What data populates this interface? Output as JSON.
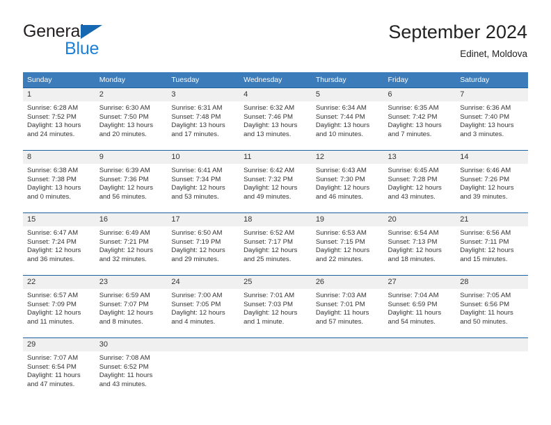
{
  "brand": {
    "name_line1": "General",
    "name_line2": "Blue",
    "color_dark": "#231f20",
    "color_blue": "#1a80d9",
    "triangle_color": "#1667b2"
  },
  "header": {
    "title": "September 2024",
    "subtitle": "Edinet, Moldova"
  },
  "theme": {
    "header_bg": "#3c7cba",
    "row_border": "#1a5fa0",
    "daynum_bg": "#f0f0f0",
    "text": "#333333"
  },
  "weekdays": [
    "Sunday",
    "Monday",
    "Tuesday",
    "Wednesday",
    "Thursday",
    "Friday",
    "Saturday"
  ],
  "weeks": [
    [
      {
        "day": "1",
        "sunrise": "Sunrise: 6:28 AM",
        "sunset": "Sunset: 7:52 PM",
        "daylight1": "Daylight: 13 hours",
        "daylight2": "and 24 minutes."
      },
      {
        "day": "2",
        "sunrise": "Sunrise: 6:30 AM",
        "sunset": "Sunset: 7:50 PM",
        "daylight1": "Daylight: 13 hours",
        "daylight2": "and 20 minutes."
      },
      {
        "day": "3",
        "sunrise": "Sunrise: 6:31 AM",
        "sunset": "Sunset: 7:48 PM",
        "daylight1": "Daylight: 13 hours",
        "daylight2": "and 17 minutes."
      },
      {
        "day": "4",
        "sunrise": "Sunrise: 6:32 AM",
        "sunset": "Sunset: 7:46 PM",
        "daylight1": "Daylight: 13 hours",
        "daylight2": "and 13 minutes."
      },
      {
        "day": "5",
        "sunrise": "Sunrise: 6:34 AM",
        "sunset": "Sunset: 7:44 PM",
        "daylight1": "Daylight: 13 hours",
        "daylight2": "and 10 minutes."
      },
      {
        "day": "6",
        "sunrise": "Sunrise: 6:35 AM",
        "sunset": "Sunset: 7:42 PM",
        "daylight1": "Daylight: 13 hours",
        "daylight2": "and 7 minutes."
      },
      {
        "day": "7",
        "sunrise": "Sunrise: 6:36 AM",
        "sunset": "Sunset: 7:40 PM",
        "daylight1": "Daylight: 13 hours",
        "daylight2": "and 3 minutes."
      }
    ],
    [
      {
        "day": "8",
        "sunrise": "Sunrise: 6:38 AM",
        "sunset": "Sunset: 7:38 PM",
        "daylight1": "Daylight: 13 hours",
        "daylight2": "and 0 minutes."
      },
      {
        "day": "9",
        "sunrise": "Sunrise: 6:39 AM",
        "sunset": "Sunset: 7:36 PM",
        "daylight1": "Daylight: 12 hours",
        "daylight2": "and 56 minutes."
      },
      {
        "day": "10",
        "sunrise": "Sunrise: 6:41 AM",
        "sunset": "Sunset: 7:34 PM",
        "daylight1": "Daylight: 12 hours",
        "daylight2": "and 53 minutes."
      },
      {
        "day": "11",
        "sunrise": "Sunrise: 6:42 AM",
        "sunset": "Sunset: 7:32 PM",
        "daylight1": "Daylight: 12 hours",
        "daylight2": "and 49 minutes."
      },
      {
        "day": "12",
        "sunrise": "Sunrise: 6:43 AM",
        "sunset": "Sunset: 7:30 PM",
        "daylight1": "Daylight: 12 hours",
        "daylight2": "and 46 minutes."
      },
      {
        "day": "13",
        "sunrise": "Sunrise: 6:45 AM",
        "sunset": "Sunset: 7:28 PM",
        "daylight1": "Daylight: 12 hours",
        "daylight2": "and 43 minutes."
      },
      {
        "day": "14",
        "sunrise": "Sunrise: 6:46 AM",
        "sunset": "Sunset: 7:26 PM",
        "daylight1": "Daylight: 12 hours",
        "daylight2": "and 39 minutes."
      }
    ],
    [
      {
        "day": "15",
        "sunrise": "Sunrise: 6:47 AM",
        "sunset": "Sunset: 7:24 PM",
        "daylight1": "Daylight: 12 hours",
        "daylight2": "and 36 minutes."
      },
      {
        "day": "16",
        "sunrise": "Sunrise: 6:49 AM",
        "sunset": "Sunset: 7:21 PM",
        "daylight1": "Daylight: 12 hours",
        "daylight2": "and 32 minutes."
      },
      {
        "day": "17",
        "sunrise": "Sunrise: 6:50 AM",
        "sunset": "Sunset: 7:19 PM",
        "daylight1": "Daylight: 12 hours",
        "daylight2": "and 29 minutes."
      },
      {
        "day": "18",
        "sunrise": "Sunrise: 6:52 AM",
        "sunset": "Sunset: 7:17 PM",
        "daylight1": "Daylight: 12 hours",
        "daylight2": "and 25 minutes."
      },
      {
        "day": "19",
        "sunrise": "Sunrise: 6:53 AM",
        "sunset": "Sunset: 7:15 PM",
        "daylight1": "Daylight: 12 hours",
        "daylight2": "and 22 minutes."
      },
      {
        "day": "20",
        "sunrise": "Sunrise: 6:54 AM",
        "sunset": "Sunset: 7:13 PM",
        "daylight1": "Daylight: 12 hours",
        "daylight2": "and 18 minutes."
      },
      {
        "day": "21",
        "sunrise": "Sunrise: 6:56 AM",
        "sunset": "Sunset: 7:11 PM",
        "daylight1": "Daylight: 12 hours",
        "daylight2": "and 15 minutes."
      }
    ],
    [
      {
        "day": "22",
        "sunrise": "Sunrise: 6:57 AM",
        "sunset": "Sunset: 7:09 PM",
        "daylight1": "Daylight: 12 hours",
        "daylight2": "and 11 minutes."
      },
      {
        "day": "23",
        "sunrise": "Sunrise: 6:59 AM",
        "sunset": "Sunset: 7:07 PM",
        "daylight1": "Daylight: 12 hours",
        "daylight2": "and 8 minutes."
      },
      {
        "day": "24",
        "sunrise": "Sunrise: 7:00 AM",
        "sunset": "Sunset: 7:05 PM",
        "daylight1": "Daylight: 12 hours",
        "daylight2": "and 4 minutes."
      },
      {
        "day": "25",
        "sunrise": "Sunrise: 7:01 AM",
        "sunset": "Sunset: 7:03 PM",
        "daylight1": "Daylight: 12 hours",
        "daylight2": "and 1 minute."
      },
      {
        "day": "26",
        "sunrise": "Sunrise: 7:03 AM",
        "sunset": "Sunset: 7:01 PM",
        "daylight1": "Daylight: 11 hours",
        "daylight2": "and 57 minutes."
      },
      {
        "day": "27",
        "sunrise": "Sunrise: 7:04 AM",
        "sunset": "Sunset: 6:59 PM",
        "daylight1": "Daylight: 11 hours",
        "daylight2": "and 54 minutes."
      },
      {
        "day": "28",
        "sunrise": "Sunrise: 7:05 AM",
        "sunset": "Sunset: 6:56 PM",
        "daylight1": "Daylight: 11 hours",
        "daylight2": "and 50 minutes."
      }
    ],
    [
      {
        "day": "29",
        "sunrise": "Sunrise: 7:07 AM",
        "sunset": "Sunset: 6:54 PM",
        "daylight1": "Daylight: 11 hours",
        "daylight2": "and 47 minutes."
      },
      {
        "day": "30",
        "sunrise": "Sunrise: 7:08 AM",
        "sunset": "Sunset: 6:52 PM",
        "daylight1": "Daylight: 11 hours",
        "daylight2": "and 43 minutes."
      },
      {
        "day": "",
        "sunrise": "",
        "sunset": "",
        "daylight1": "",
        "daylight2": ""
      },
      {
        "day": "",
        "sunrise": "",
        "sunset": "",
        "daylight1": "",
        "daylight2": ""
      },
      {
        "day": "",
        "sunrise": "",
        "sunset": "",
        "daylight1": "",
        "daylight2": ""
      },
      {
        "day": "",
        "sunrise": "",
        "sunset": "",
        "daylight1": "",
        "daylight2": ""
      },
      {
        "day": "",
        "sunrise": "",
        "sunset": "",
        "daylight1": "",
        "daylight2": ""
      }
    ]
  ]
}
